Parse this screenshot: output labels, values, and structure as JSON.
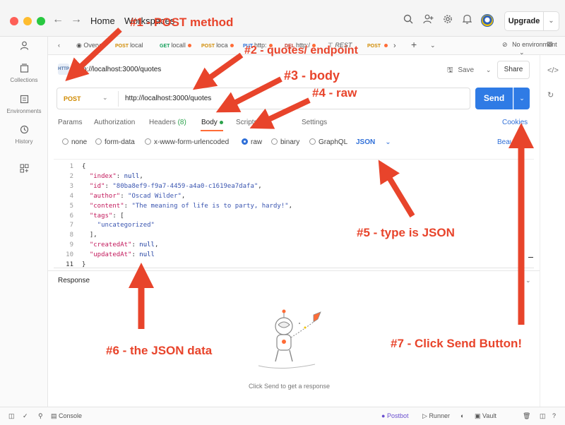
{
  "titlebar": {
    "home": "Home",
    "workspace": "Workspaces",
    "upgrade": "Upgrade"
  },
  "sidebar": {
    "items": [
      {
        "label": "",
        "icon": "user-icon"
      },
      {
        "label": "Collections",
        "icon": "collections-icon"
      },
      {
        "label": "Environments",
        "icon": "environments-icon"
      },
      {
        "label": "History",
        "icon": "history-icon"
      },
      {
        "label": "",
        "icon": "apps-icon"
      }
    ]
  },
  "tabs": [
    {
      "method": "",
      "label": "Overv"
    },
    {
      "method": "POST",
      "label": "local"
    },
    {
      "method": "GET",
      "label": "locall"
    },
    {
      "method": "POST",
      "label": "loca"
    },
    {
      "method": "PUT",
      "label": "http:"
    },
    {
      "method": "DEL",
      "label": "http:/"
    },
    {
      "method": "",
      "label": "REST"
    },
    {
      "method": "POST",
      "label": ""
    }
  ],
  "environment": "No environment",
  "request": {
    "title": "http://localhost:3000/quotes",
    "save": "Save",
    "share": "Share",
    "method": "POST",
    "url": "http://localhost:3000/quotes",
    "send": "Send"
  },
  "option_tabs": {
    "params": "Params",
    "authorization": "Authorization",
    "headers": "Headers",
    "headers_count": "(8)",
    "body": "Body",
    "scripts": "Scripts",
    "settings": "Settings",
    "cookies": "Cookies"
  },
  "body_types": {
    "none": "none",
    "form_data": "form-data",
    "urlencoded": "x-www-form-urlencoded",
    "raw": "raw",
    "binary": "binary",
    "graphql": "GraphQL",
    "selected": "raw",
    "format": "JSON",
    "beautify": "Beautify"
  },
  "code_lines": [
    {
      "n": "1",
      "text": "{"
    },
    {
      "n": "2",
      "text": "  \"index\": null,"
    },
    {
      "n": "3",
      "text": "  \"id\": \"80ba8ef9-f9a7-4459-a4a0-c1619ea7dafa\","
    },
    {
      "n": "4",
      "text": "  \"author\": \"Oscad Wilder\","
    },
    {
      "n": "5",
      "text": "  \"content\": \"The meaning of life is to party, hardy!\","
    },
    {
      "n": "6",
      "text": "  \"tags\": ["
    },
    {
      "n": "7",
      "text": "    \"uncategorized\""
    },
    {
      "n": "8",
      "text": "  ],"
    },
    {
      "n": "9",
      "text": "  \"createdAt\": null,"
    },
    {
      "n": "10",
      "text": "  \"updatedAt\": null"
    },
    {
      "n": "11",
      "text": "}"
    }
  ],
  "response": {
    "label": "Response",
    "empty": "Click Send to get a response"
  },
  "statusbar": {
    "console": "Console",
    "postbot": "Postbot",
    "runner": "Runner",
    "vault": "Vault"
  },
  "annotations": {
    "a1": "#1 - POST method",
    "a2": "#2 - quotes/ endpoint",
    "a3": "#3 - body",
    "a4": "#4 - raw",
    "a5": "#5 - type is JSON",
    "a6": "#6 - the JSON data",
    "a7": "#7 - Click Send Button!"
  },
  "colors": {
    "accent": "#2f7be5",
    "annotation": "#e8442b",
    "post_method": "#d08a00"
  }
}
